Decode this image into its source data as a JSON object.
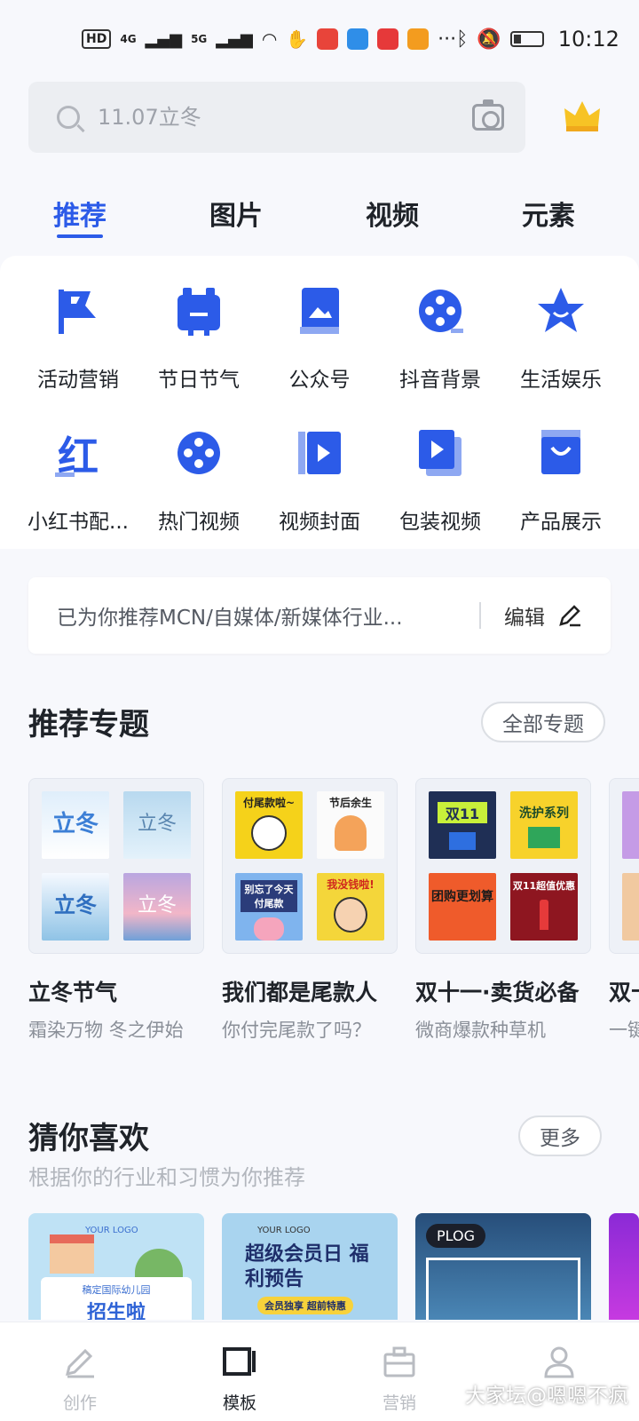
{
  "status_bar": {
    "hd": "HD",
    "net_4g": "4G",
    "net_5g": "5G",
    "more": "···",
    "time": "10:12"
  },
  "search": {
    "placeholder": "11.07立冬"
  },
  "tabs": [
    {
      "label": "推荐",
      "active": true
    },
    {
      "label": "图片",
      "active": false
    },
    {
      "label": "视频",
      "active": false
    },
    {
      "label": "元素",
      "active": false
    }
  ],
  "categories": [
    {
      "label": "活动营销",
      "icon": "flag-icon"
    },
    {
      "label": "节日节气",
      "icon": "calendar-icon"
    },
    {
      "label": "公众号",
      "icon": "picture-book-icon"
    },
    {
      "label": "抖音背景",
      "icon": "film-reel-icon"
    },
    {
      "label": "生活娱乐",
      "icon": "star-icon"
    },
    {
      "label": "小红书配...",
      "icon": "red-note-icon"
    },
    {
      "label": "热门视频",
      "icon": "reel-icon"
    },
    {
      "label": "视频封面",
      "icon": "video-cover-icon"
    },
    {
      "label": "包装视频",
      "icon": "video-package-icon"
    },
    {
      "label": "产品展示",
      "icon": "shopping-bag-icon"
    }
  ],
  "recommend_bar": {
    "text": "已为你推荐MCN/自媒体/新媒体行业...",
    "edit_label": "编辑"
  },
  "topics_section": {
    "title": "推荐专题",
    "all_label": "全部专题",
    "items": [
      {
        "title": "立冬节气",
        "subtitle": "霜染万物 冬之伊始"
      },
      {
        "title": "我们都是尾款人",
        "subtitle": "你付完尾款了吗？"
      },
      {
        "title": "双十一·卖货必备",
        "subtitle": "微商爆款种草机"
      },
      {
        "title": "双十",
        "subtitle": "一键"
      }
    ],
    "thumb_texts": {
      "t1": "立冬",
      "t2": "立冬",
      "t3": "立冬",
      "t4": "立冬",
      "p1": "付尾款啦~",
      "p2": "节后余生",
      "p3": "别忘了今天付尾款",
      "p4": "我没钱啦!",
      "d1": "双11",
      "d2": "洗护系列",
      "d3": "团购更划算",
      "d4": "双11超值优惠"
    }
  },
  "guess_section": {
    "title": "猜你喜欢",
    "subtitle": "根据你的行业和习惯为你推荐",
    "more_label": "更多",
    "cards": [
      {
        "logo": "YOUR LOGO",
        "caption": "稿定国际幼儿园",
        "headline": "招生啦"
      },
      {
        "logo": "YOUR LOGO",
        "headline": "超级会员日 福利预告",
        "caption": "会员独享 超前特惠"
      },
      {
        "badge": "PLOG"
      }
    ]
  },
  "bottom_nav": [
    {
      "label": "创作",
      "icon": "pen-icon",
      "active": false
    },
    {
      "label": "模板",
      "icon": "template-icon",
      "active": true
    },
    {
      "label": "营销",
      "icon": "briefcase-icon",
      "active": false
    },
    {
      "label": "",
      "icon": "user-icon",
      "active": false
    }
  ],
  "watermark": "大家坛@嗯嗯不疯",
  "colors": {
    "accent": "#2c5be8",
    "crown": "#f7c325"
  }
}
